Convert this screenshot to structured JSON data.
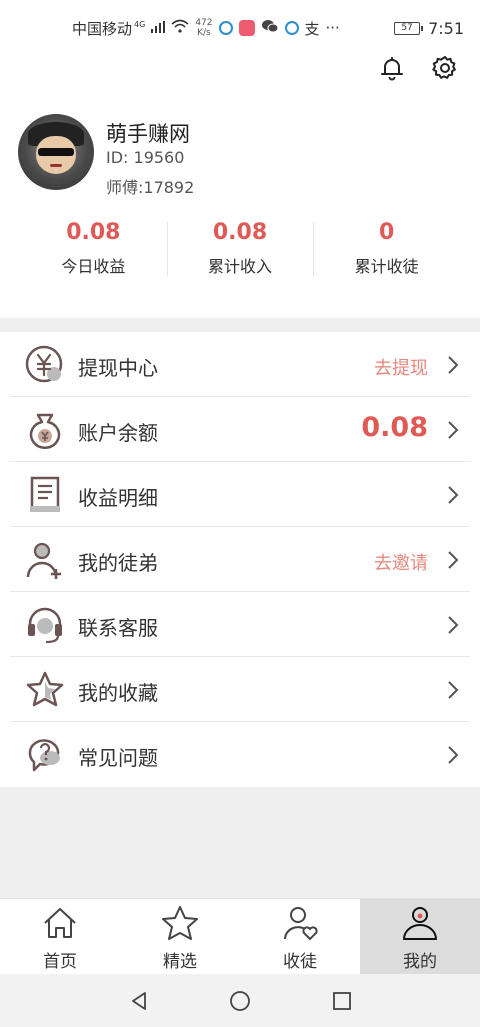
{
  "status_bar": {
    "carrier": "中国移动",
    "network": "4G",
    "speed_value": "472",
    "speed_unit": "K/s",
    "more": "···",
    "battery": "57",
    "time": "7:51"
  },
  "header": {
    "icons": [
      "bell-icon",
      "gear-icon"
    ]
  },
  "profile": {
    "nickname": "萌手赚网",
    "id_text": "ID: 19560",
    "master_text": "师傅:17892"
  },
  "stats": [
    {
      "value": "0.08",
      "label": "今日收益"
    },
    {
      "value": "0.08",
      "label": "累计收入"
    },
    {
      "value": "0",
      "label": "累计收徒"
    }
  ],
  "menu": [
    {
      "label": "提现中心",
      "extra": "去提现",
      "icon": "yuan-withdraw-icon"
    },
    {
      "label": "账户余额",
      "extra": "0.08",
      "icon": "money-bag-icon"
    },
    {
      "label": "收益明细",
      "extra": "",
      "icon": "document-icon"
    },
    {
      "label": "我的徒弟",
      "extra": "去邀请",
      "icon": "add-user-icon"
    },
    {
      "label": "联系客服",
      "extra": "",
      "icon": "headset-icon"
    },
    {
      "label": "我的收藏",
      "extra": "",
      "icon": "star-icon"
    },
    {
      "label": "常见问题",
      "extra": "",
      "icon": "question-bubble-icon"
    }
  ],
  "tabs": [
    {
      "label": "首页",
      "icon": "home-icon",
      "active": false
    },
    {
      "label": "精选",
      "icon": "star-icon",
      "active": false
    },
    {
      "label": "收徒",
      "icon": "user-heart-icon",
      "active": false
    },
    {
      "label": "我的",
      "icon": "profile-icon",
      "active": true
    }
  ],
  "colors": {
    "accent": "#e05a55",
    "accent_light": "#e8887f",
    "icon_brown": "#6b5454"
  }
}
